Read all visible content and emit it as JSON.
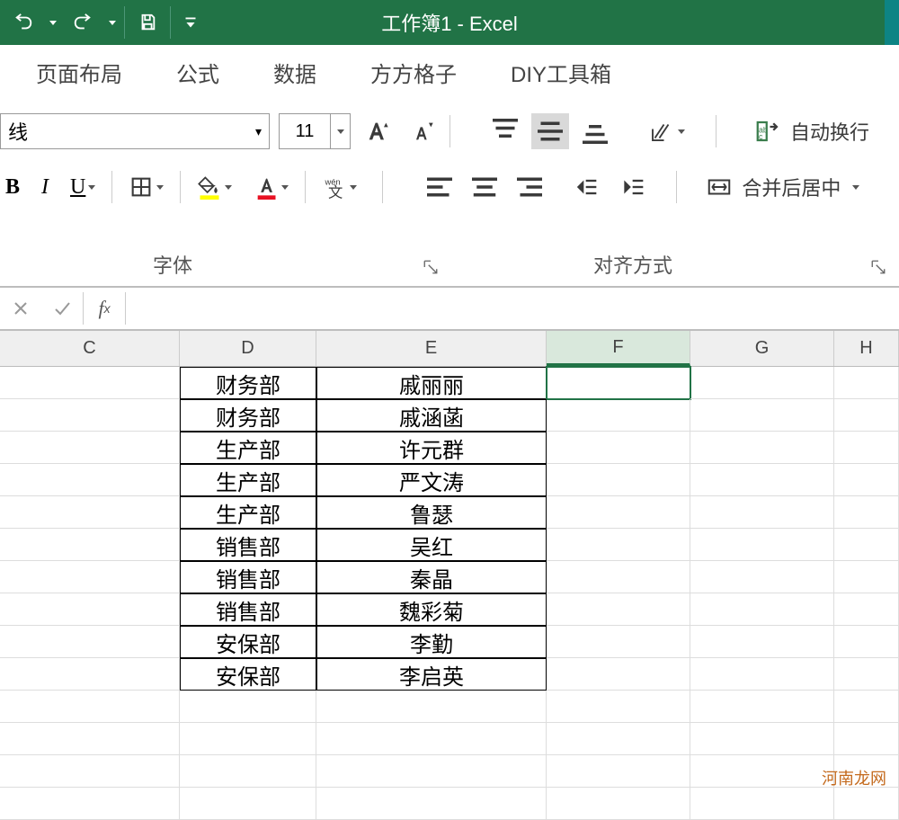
{
  "titlebar": {
    "title": "工作簿1 - Excel"
  },
  "tabs": [
    "页面布局",
    "公式",
    "数据",
    "方方格子",
    "DIY工具箱"
  ],
  "ribbon": {
    "font_name": "线",
    "font_size": "11",
    "groups": {
      "font": "字体",
      "align": "对齐方式"
    },
    "wrap_text": "自动换行",
    "merge_center": "合并后居中"
  },
  "columns": [
    "C",
    "D",
    "E",
    "F",
    "G",
    "H"
  ],
  "selected_column_index": 3,
  "table": [
    {
      "dept": "财务部",
      "name": "戚丽丽"
    },
    {
      "dept": "财务部",
      "name": "戚涵菡"
    },
    {
      "dept": "生产部",
      "name": "许元群"
    },
    {
      "dept": "生产部",
      "name": "严文涛"
    },
    {
      "dept": "生产部",
      "name": "鲁瑟"
    },
    {
      "dept": "销售部",
      "name": "吴红"
    },
    {
      "dept": "销售部",
      "name": "秦晶"
    },
    {
      "dept": "销售部",
      "name": "魏彩菊"
    },
    {
      "dept": "安保部",
      "name": "李勤"
    },
    {
      "dept": "安保部",
      "name": "李启英"
    }
  ],
  "watermark": "河南龙网"
}
